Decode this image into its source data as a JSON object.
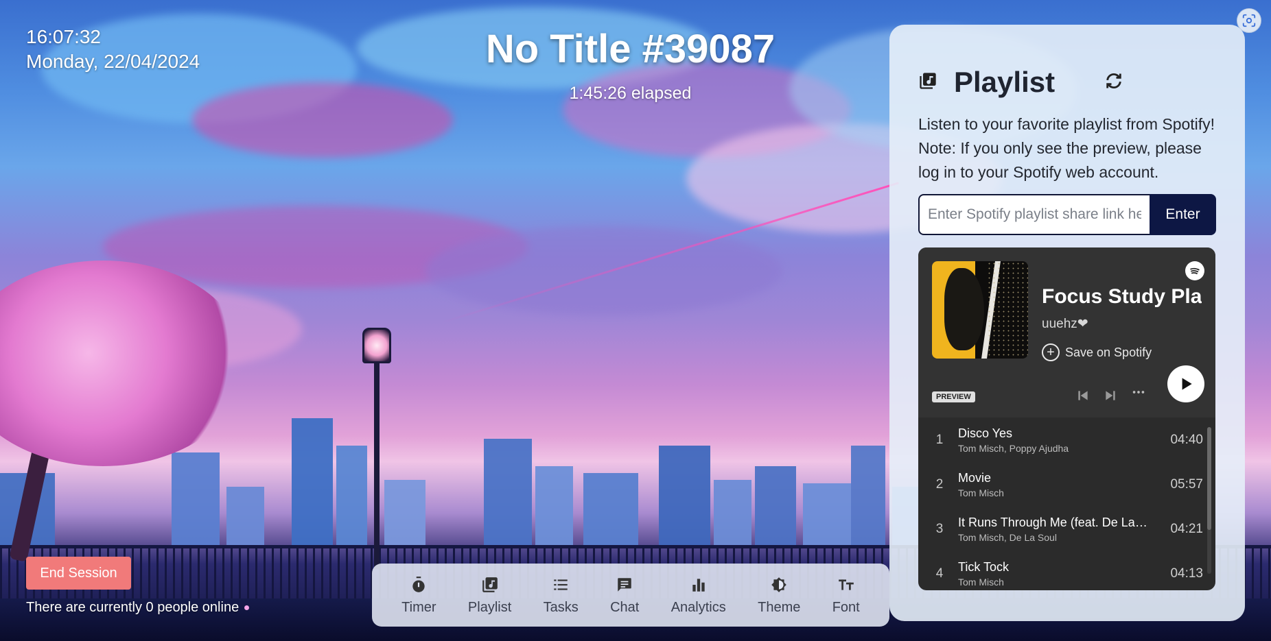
{
  "clock": {
    "time": "16:07:32",
    "date": "Monday, 22/04/2024"
  },
  "session": {
    "title": "No Title #39087",
    "elapsed": "1:45:26 elapsed"
  },
  "footer": {
    "end_session_label": "End Session",
    "online_text": "There are currently 0 people online"
  },
  "dock": {
    "items": [
      {
        "label": "Timer",
        "icon": "stopwatch-icon"
      },
      {
        "label": "Playlist",
        "icon": "music-library-icon"
      },
      {
        "label": "Tasks",
        "icon": "list-icon"
      },
      {
        "label": "Chat",
        "icon": "chat-bubble-icon"
      },
      {
        "label": "Analytics",
        "icon": "bar-chart-icon"
      },
      {
        "label": "Theme",
        "icon": "contrast-icon"
      },
      {
        "label": "Font",
        "icon": "text-size-icon"
      }
    ]
  },
  "playlist_panel": {
    "title": "Playlist",
    "description_1": "Listen to your favorite playlist from Spotify!",
    "description_2": "Note: If you only see the preview, please log in to your Spotify web account.",
    "link_placeholder": "Enter Spotify playlist share link here",
    "enter_label": "Enter",
    "icons": {
      "header": "music-library-icon",
      "refresh": "refresh-icon"
    }
  },
  "spotify_embed": {
    "playlist_name": "Focus Study Playlist",
    "owner": "uuehz❤",
    "save_label": "Save on Spotify",
    "preview_badge": "PREVIEW",
    "tracks": [
      {
        "num": "1",
        "name": "Disco Yes",
        "artist": "Tom Misch, Poppy Ajudha",
        "duration": "04:40"
      },
      {
        "num": "2",
        "name": "Movie",
        "artist": "Tom Misch",
        "duration": "05:57"
      },
      {
        "num": "3",
        "name": "It Runs Through Me (feat. De La Soul)",
        "artist": "Tom Misch, De La Soul",
        "duration": "04:21"
      },
      {
        "num": "4",
        "name": "Tick Tock",
        "artist": "Tom Misch",
        "duration": "04:13"
      }
    ]
  },
  "colors": {
    "end_session": "#f17a7a",
    "enter_button": "#0d1744",
    "spotify_bg": "#2b2b2b",
    "panel_bg": "#e6eef8"
  }
}
